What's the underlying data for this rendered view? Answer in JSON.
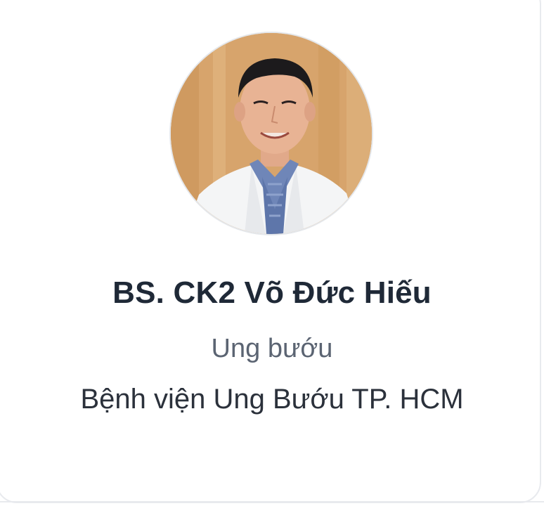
{
  "doctor": {
    "name": "BS. CK2 Võ Đức Hiếu",
    "specialty": "Ung bướu",
    "hospital": "Bệnh viện Ung Bướu TP. HCM",
    "avatar_icon": "doctor-portrait"
  },
  "colors": {
    "name_text": "#1f2937",
    "specialty_text": "#5b6472",
    "hospital_text": "#2b313b",
    "card_border": "#e8eaee"
  }
}
